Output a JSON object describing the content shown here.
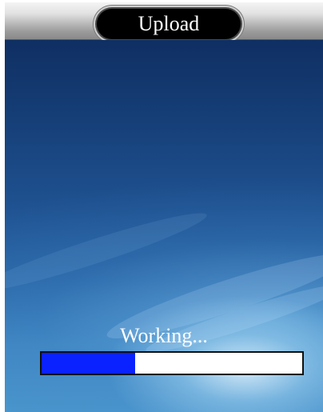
{
  "header": {
    "title": "Upload"
  },
  "status": {
    "text": "Working..."
  },
  "progress": {
    "fraction": 0.36,
    "fill_color": "#0a22ff",
    "track_color": "#ffffff"
  },
  "colors": {
    "pill_background": "#000000",
    "title_text": "#ffffff"
  }
}
